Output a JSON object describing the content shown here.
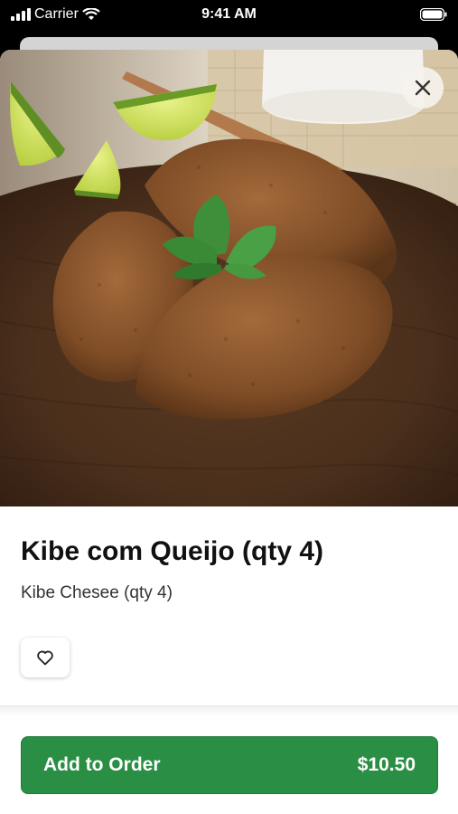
{
  "status_bar": {
    "carrier": "Carrier",
    "time": "9:41 AM"
  },
  "item": {
    "name": "Kibe com Queijo (qty 4)",
    "description": "Kibe Chesee (qty 4)",
    "image_icon": "kibe-photo"
  },
  "actions": {
    "add_label": "Add to Order",
    "price": "$10.50"
  },
  "icons": {
    "close": "close-icon",
    "favorite": "heart-icon"
  },
  "colors": {
    "accent": "#2a8f45",
    "text": "#111111"
  }
}
